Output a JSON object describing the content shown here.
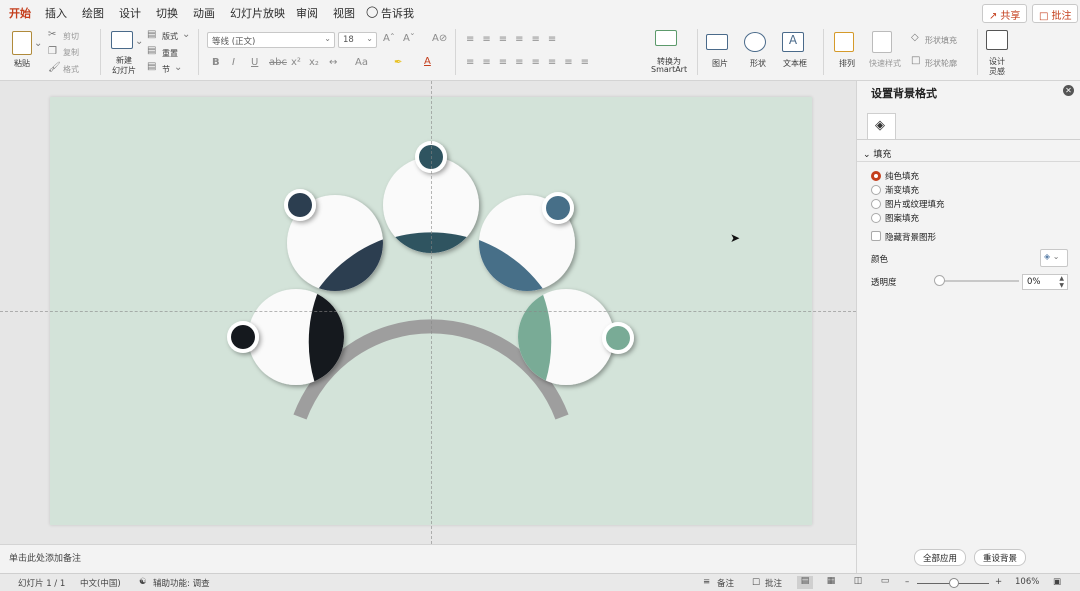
{
  "menu_tabs": [
    "开始",
    "插入",
    "绘图",
    "设计",
    "切换",
    "动画",
    "幻灯片放映",
    "审阅",
    "视图",
    "告诉我"
  ],
  "header_buttons": {
    "share": "共享",
    "comment": "批注"
  },
  "ribbon": {
    "paste": "粘贴",
    "cut": "剪切",
    "copy": "复制",
    "format_painter": "格式",
    "new_slide_line1": "新建",
    "new_slide_line2": "幻灯片",
    "layout": "版式",
    "reset": "重置",
    "section": "节",
    "font_name": "等线 (正文)",
    "font_size": "18",
    "convert_smartart_line1": "转换为",
    "convert_smartart_line2": "SmartArt",
    "picture": "图片",
    "shape": "形状",
    "textbox": "文本框",
    "arrange": "排列",
    "quick_styles": "快速样式",
    "shape_fill": "形状填充",
    "shape_outline": "形状轮廓",
    "design_ideas_line1": "设计",
    "design_ideas_line2": "灵感"
  },
  "notes_placeholder": "单击此处添加备注",
  "format_pane": {
    "title": "设置背景格式",
    "section_fill": "填充",
    "options": [
      "纯色填充",
      "渐变填充",
      "图片或纹理填充",
      "图案填充"
    ],
    "selected_option": "纯色填充",
    "hide_bg_graphics": "隐藏背景图形",
    "color_label": "颜色",
    "transparency_label": "透明度",
    "transparency_value": "0%",
    "transparency": 0,
    "apply_all": "全部应用",
    "reset_background": "重设背景"
  },
  "status": {
    "slide_info": "幻灯片 1 / 1",
    "language": "中文(中国)",
    "accessibility": "辅助功能: 调查",
    "notes": "备注",
    "comments": "批注",
    "zoom": "106%"
  },
  "colors": {
    "accent": "#c43e1c",
    "slide_bg": "#d3e3d9",
    "navy": "#2c3e50",
    "teal_dark": "#2f5460",
    "steel_blue": "#476f88",
    "near_black": "#15191e",
    "sage": "#79ab96"
  }
}
